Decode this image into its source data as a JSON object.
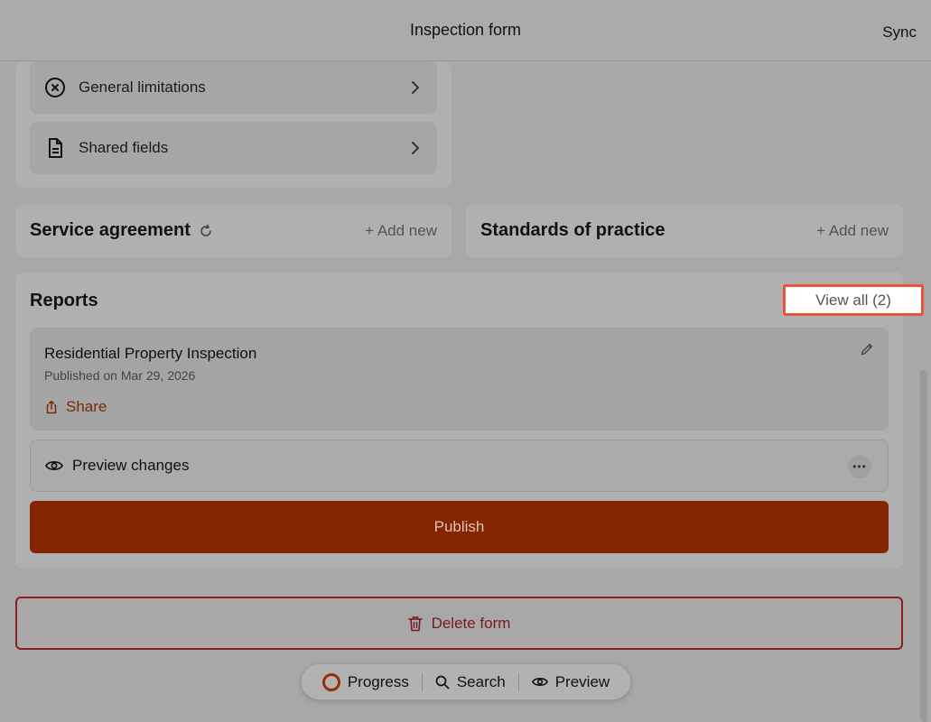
{
  "header": {
    "title": "Inspection form",
    "sync_label": "Sync"
  },
  "checklist": {
    "items": [
      {
        "label": "General limitations",
        "icon": "x-circle-icon"
      },
      {
        "label": "Shared fields",
        "icon": "document-icon"
      }
    ]
  },
  "service_agreement": {
    "title": "Service agreement",
    "add_label": "+ Add new"
  },
  "standards": {
    "title": "Standards of practice",
    "add_label": "+ Add new"
  },
  "reports": {
    "title": "Reports",
    "view_all_label": "View all (2)",
    "report": {
      "title": "Residential Property Inspection",
      "published": "Published on Mar 29, 2026",
      "share_label": "Share"
    },
    "preview_label": "Preview changes",
    "more_label": "•••",
    "publish_label": "Publish"
  },
  "delete_label": "Delete form",
  "bottom_nav": {
    "progress_label": "Progress",
    "search_label": "Search",
    "preview_label": "Preview"
  },
  "colors": {
    "accent": "#852400",
    "danger": "#8a1c22",
    "highlight": "#e8533a",
    "overlay_bg": "#a8a8a8"
  }
}
